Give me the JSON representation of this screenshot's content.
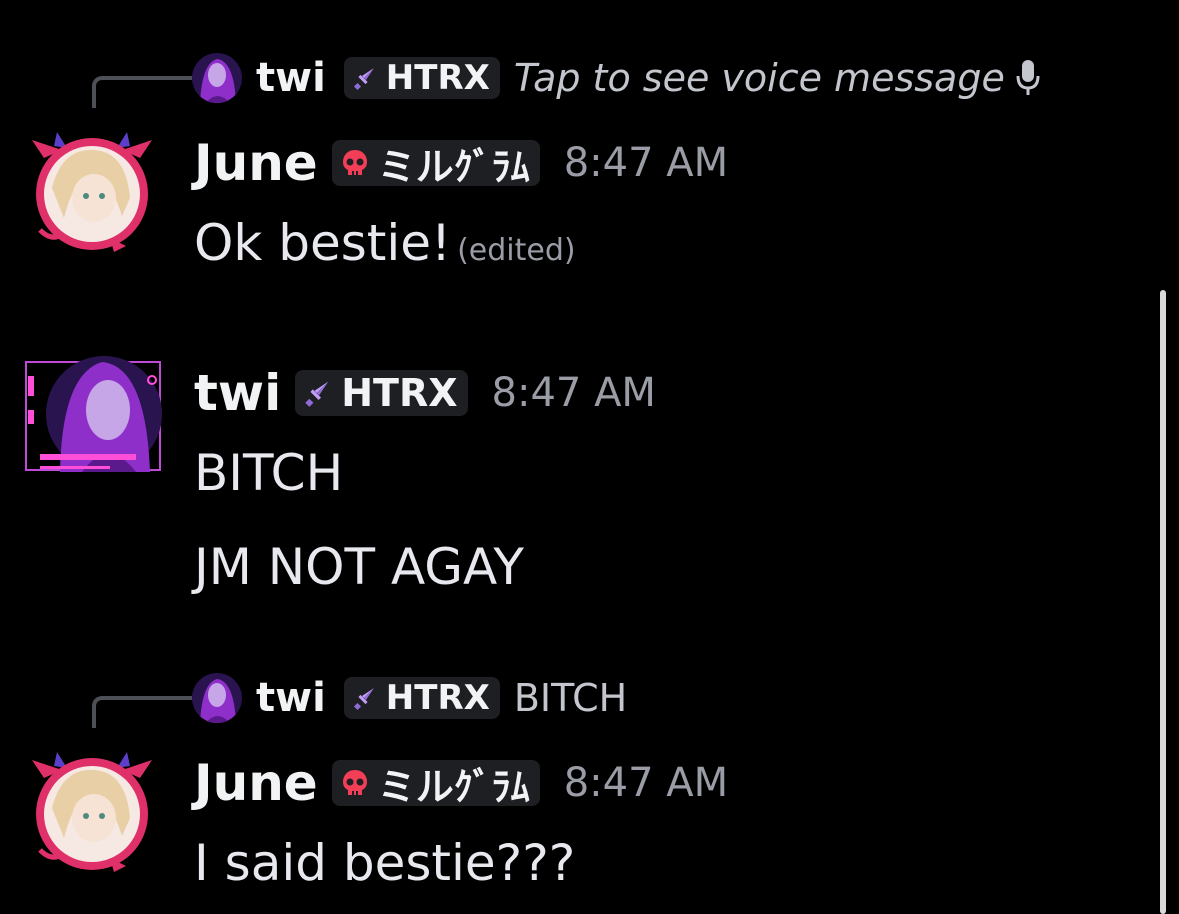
{
  "messages": [
    {
      "reply": {
        "username": "twi",
        "tag": "HTRX",
        "preview": "Tap to see voice message"
      },
      "username": "June",
      "tag": "ミルｸﾞﾗﾑ",
      "time": "8:47 AM",
      "lines": [
        "Ok bestie!"
      ],
      "edited_label": "(edited)"
    },
    {
      "username": "twi",
      "tag": "HTRX",
      "time": "8:47 AM",
      "lines": [
        "BITCH",
        "JM NOT AGAY"
      ]
    },
    {
      "reply": {
        "username": "twi",
        "tag": "HTRX",
        "preview": "BITCH"
      },
      "username": "June",
      "tag": "ミルｸﾞﾗﾑ",
      "time": "8:47 AM",
      "lines": [
        "I said bestie???"
      ]
    }
  ],
  "colors": {
    "background": "#000000",
    "username": "#f2f3f5",
    "timestamp": "#9a9ca6",
    "tag_bg": "#1e1f22",
    "skull": "#f23f57",
    "sword": "#c29cf5"
  }
}
